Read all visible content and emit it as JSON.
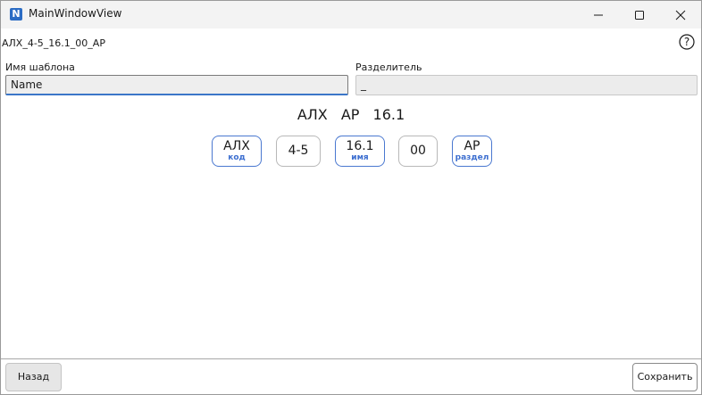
{
  "window": {
    "title": "MainWindowView",
    "app_icon_letter": "N"
  },
  "header": {
    "document_name": "АЛХ_4-5_16.1_00_АР"
  },
  "form": {
    "template_label": "Имя шаблона",
    "template_value": "Name",
    "separator_label": "Разделитель",
    "separator_value": "_"
  },
  "preview": {
    "text": "АЛХ АР 16.1"
  },
  "segments": [
    {
      "value": "АЛХ",
      "tag": "код"
    },
    {
      "value": "4-5",
      "tag": ""
    },
    {
      "value": "16.1",
      "tag": "имя"
    },
    {
      "value": "00",
      "tag": ""
    },
    {
      "value": "АР",
      "tag": "раздел"
    }
  ],
  "footer": {
    "back_label": "Назад",
    "save_label": "Сохранить"
  },
  "colors": {
    "accent": "#3d6fd0",
    "titlebar": "#f3f3f3"
  }
}
